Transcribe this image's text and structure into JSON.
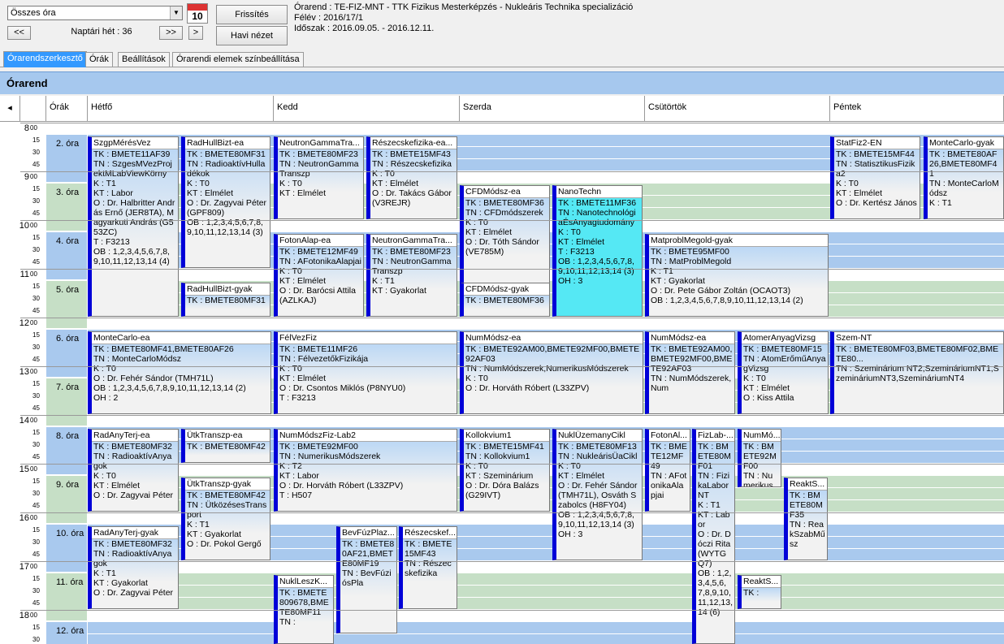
{
  "toolbar": {
    "select_value": "Összes óra",
    "cal_day": "10",
    "refresh_label": "Frissítés",
    "monthly_label": "Havi nézet",
    "prev_fast": "<<",
    "next_fast": ">>",
    "next": ">",
    "week_label": "Naptári hét : 36"
  },
  "info": {
    "line1": "Órarend : TE-FIZ-MNT - TTK Fizikus Mesterképzés - Nukleáris Technika specializáció",
    "line2": "Félév : 2016/17/1",
    "line3": "Időszak : 2016.09.05. - 2016.12.11."
  },
  "tabs": [
    "Órarendszerkesztő",
    "Órák",
    "Beállítások",
    "Órarendi elemek színbeállítása"
  ],
  "section_title": "Órarend",
  "grid": {
    "nav": "◂",
    "orak": "Órák",
    "days": [
      "Hétfő",
      "Kedd",
      "Szerda",
      "Csütörtök",
      "Péntek"
    ],
    "hours": [
      "8",
      "9",
      "10",
      "11",
      "12",
      "13",
      "14",
      "15",
      "16",
      "17",
      "18"
    ],
    "quarters": [
      "00",
      "15",
      "30",
      "45"
    ],
    "slots": [
      "2. óra",
      "3. óra",
      "4. óra",
      "5. óra",
      "6. óra",
      "7. óra",
      "8. óra",
      "9. óra",
      "10. óra",
      "11. óra",
      "12. óra"
    ]
  },
  "events": [
    {
      "h": "SzgpMérésVez",
      "b": "TK : BMETE11AF39\nTN : SzgesMVezProjektMLabViewKörny\nK : T1\nKT : Labor\nO : Dr. Halbritter András Ernő (JER8TA), Magyarkuti András (G553ZC)\nT : F3213\nOB : 1,2,3,4,5,6,7,8,9,10,11,12,13,14 (4)"
    },
    {
      "h": "RadHullBizt-ea",
      "b": "TK : BMETE80MF31\nTN : RadioaktívHulladékok\nK : T0\nKT : Elmélet\nO : Dr. Zagyvai Péter (GPF809)\nOB : 1,2,3,4,5,6,7,8,9,10,11,12,13,14 (3)"
    },
    {
      "h": "RadHullBizt-gyak",
      "b": "TK : BMETE80MF31"
    },
    {
      "h": "NeutronGammaTra...",
      "b": "TK : BMETE80MF23\nTN : NeutronGammaTranszp\nK : T0\nKT : Elmélet"
    },
    {
      "h": "Részecskefizika-ea...",
      "b": "TK : BMETE15MF43\nTN : Részecskefizika\nK : T0\nKT : Elmélet\nO : Dr. Takács Gábor (V3REJR)"
    },
    {
      "h": "FotonAlap-ea",
      "b": "TK : BMETE12MF49\nTN : AFotonikaAlapjai\nK : T0\nKT : Elmélet\nO : Dr. Barócsi Attila (AZLKAJ)"
    },
    {
      "h": "NeutronGammaTra...",
      "b": "TK : BMETE80MF23\nTN : NeutronGammaTranszp\nK : T1\nKT : Gyakorlat"
    },
    {
      "h": "CFDMódsz-ea",
      "b": "TK : BMETE80MF36\nTN : CFDmódszerek\nK : T0\nKT : Elmélet\nO : Dr. Tóth Sándor (VE785M)"
    },
    {
      "h": "CFDMódsz-gyak",
      "b": "TK : BMETE80MF36"
    },
    {
      "h": "NanoTechn",
      "b": "TK : BMETE11MF36\nTN : NanotechnológiaÉsAnyagtudomány\nK : T0\nKT : Elmélet\nT : F3213\nOB : 1,2,3,4,5,6,7,8,9,10,11,12,13,14 (3)\nOH : 3"
    },
    {
      "h": "MatproblMegold-gyak",
      "b": "TK : BMETE95MF00\nTN : MatProblMegold\nK : T1\nKT : Gyakorlat\nO : Dr. Pete Gábor Zoltán (OCAOT3)\nOB : 1,2,3,4,5,6,7,8,9,10,11,12,13,14 (2)"
    },
    {
      "h": "StatFiz2-EN",
      "b": "TK : BMETE15MF44\nTN : StatisztikusFizika2\nK : T0\nKT : Elmélet\nO : Dr. Kertész János"
    },
    {
      "h": "MonteCarlo-gyak",
      "b": "TK : BMETE80AF26,BMETE80MF41\nTN : MonteCarloMódsz\nK : T1"
    },
    {
      "h": "MonteCarlo-ea",
      "b": "TK : BMETE80MF41,BMETE80AF26\nTN : MonteCarloMódsz\nK : T0\nO : Dr. Fehér Sándor (TMH71L)\nOB : 1,2,3,4,5,6,7,8,9,10,11,12,13,14 (2)\nOH : 2"
    },
    {
      "h": "FélVezFiz",
      "b": "TK : BMETE11MF26\nTN : FélvezetőkFizikája\nK : T0\nKT : Elmélet\nO : Dr. Csontos Miklós (P8NYU0)\nT : F3213"
    },
    {
      "h": "NumMódsz-ea",
      "b": "TK : BMETE92AM00,BMETE92MF00,BMETE92AF03\nTN : NumMódszerek,NumerikusMódszerek\nK : T0\nO : Dr. Horváth Róbert (L33ZPV)"
    },
    {
      "h": "NumMódsz-ea",
      "b": "TK : BMETE92AM00,BMETE92MF00,BMETE92AF03\nTN : NumMódszerek,Num"
    },
    {
      "h": "AtomerAnyagVizsg",
      "b": "TK : BMETE80MF15\nTN : AtomErőműAnyagVizsg\nK : T0\nKT : Elmélet\nO : Kiss Attila"
    },
    {
      "h": "Szem-NT",
      "b": "TK : BMETE80MF03,BMETE80MF02,BMETE80...\nTN : Szeminárium NT2,SzemináriumNT1,SzemináriumNT3,SzemináriumNT4"
    },
    {
      "h": "RadAnyTerj-ea",
      "b": "TK : BMETE80MF32\nTN : RadioaktívAnyagok\nK : T0\nKT : Elmélet\nO : Dr. Zagyvai Péter"
    },
    {
      "h": "ÜtkTranszp-ea",
      "b": "TK : BMETE80MF42"
    },
    {
      "h": "ÜtkTranszp-gyak",
      "b": "TK : BMETE80MF42\nTN : ÜtközésesTransport\nK : T1\nKT : Gyakorlat\nO : Dr. Pokol Gergő"
    },
    {
      "h": "RadAnyTerj-gyak",
      "b": "TK : BMETE80MF32\nTN : RadioaktívAnyagok\nK : T1\nKT : Gyakorlat\nO : Dr. Zagyvai Péter"
    },
    {
      "h": "NumMódszFiz-Lab2",
      "b": "TK : BMETE92MF00\nTN : NumerikusMódszerek\nK : T2\nKT : Labor\nO : Dr. Horváth Róbert (L33ZPV)\nT : H507"
    },
    {
      "h": "BevFúzPlaz...",
      "b": "TK : BMETE80AF21,BMETE80MF19\nTN : BevFúziósPla"
    },
    {
      "h": "Részecskef...",
      "b": "TK : BMETE15MF43\nTN : Részecskefizika"
    },
    {
      "h": "NuklLeszK...",
      "b": "TK : BMETE809678,BMETE80MF11\nTN :"
    },
    {
      "h": "Kollokvium1",
      "b": "TK : BMETE15MF41\nTN : Kollokvium1\nK : T0\nKT : Szeminárium\nO : Dr. Dóra Balázs (G29IVT)"
    },
    {
      "h": "NuklÜzemanyCikl",
      "b": "TK : BMETE80MF13\nTN : NukleárisÜaCikl\nK : T0\nKT : Elmélet\nO : Dr. Fehér Sándor (TMH71L), Osváth Szabolcs (H8FY04)\nOB : 1,2,3,4,5,6,7,8,9,10,11,12,13,14 (3)\nOH : 3"
    },
    {
      "h": "FotonAl...",
      "b": "TK : BMETE12MF49\nTN : AFotonikaAlapjai"
    },
    {
      "h": "FizLab-...",
      "b": "TK : BMETE80MF01\nTN : FizikaLaborNT\nK : T1\nKT : Labor\nO : Dr. Dóczi Rita (WYTGQ7)\nOB : 1,2,3,4,5,6,7,8,9,10,11,12,13,14 (6)"
    },
    {
      "h": "NumMó...",
      "b": "TK : BMETE92MF00\nTN : NumerikusMódszer"
    },
    {
      "h": "ReaktS...",
      "b": "TK : BMETE80MF35\nTN : ReakSzabMűsz"
    },
    {
      "h": "ReaktS...",
      "b": "TK :"
    }
  ],
  "colors": {
    "event_border": "#0000d8",
    "slot_blue": "#a9c9ee",
    "slot_green": "#c6dfc6",
    "cyan": "#55e8f4",
    "header_bar": "#a6c8ee"
  }
}
